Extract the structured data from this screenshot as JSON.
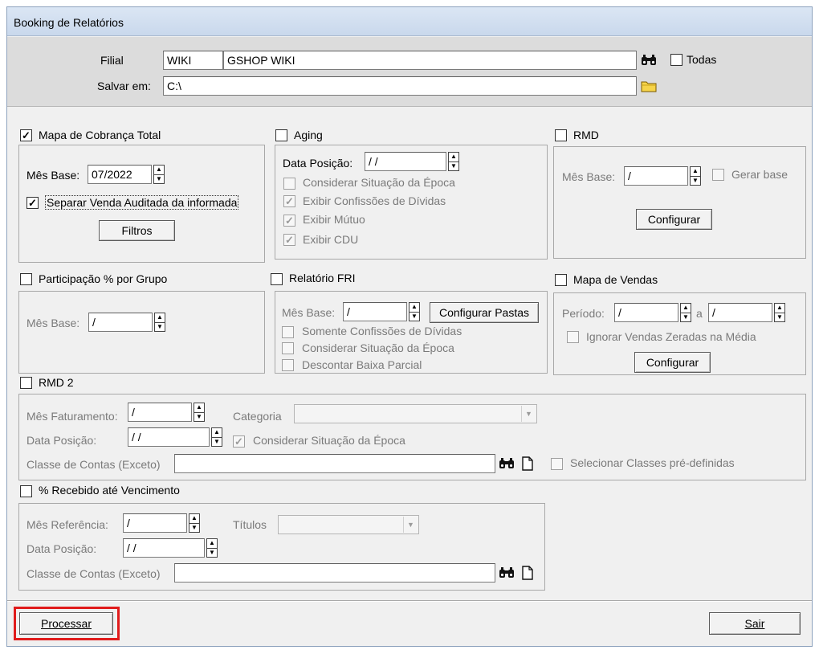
{
  "window": {
    "title": "Booking de Relatórios"
  },
  "header": {
    "filial_label": "Filial",
    "filial_code": "WIKI",
    "filial_name": "GSHOP WIKI",
    "todas_label": "Todas",
    "salvar_label": "Salvar em:",
    "salvar_path": "C:\\"
  },
  "mapa_cobranca": {
    "title": "Mapa de Cobrança Total",
    "checked": true,
    "mes_base_label": "Mês Base:",
    "mes_base_value": "07/2022",
    "separar_label": "Separar Venda Auditada da informada",
    "filtros_label": "Filtros"
  },
  "aging": {
    "title": "Aging",
    "data_posicao_label": "Data Posição:",
    "data_posicao_value": " / /",
    "opt1": "Considerar Situação da Época",
    "opt2": "Exibir Confissões de Dívidas",
    "opt3": "Exibir Mútuo",
    "opt4": "Exibir CDU"
  },
  "rmd": {
    "title": "RMD",
    "mes_base_label": "Mês Base:",
    "mes_base_value": " /",
    "gerar_base_label": "Gerar base",
    "configurar_label": "Configurar"
  },
  "participacao": {
    "title": "Participação % por Grupo",
    "mes_base_label": "Mês Base:",
    "mes_base_value": " /"
  },
  "fri": {
    "title": "Relatório FRI",
    "mes_base_label": "Mês Base:",
    "mes_base_value": " /",
    "configurar_pastas_label": "Configurar Pastas",
    "opt1": "Somente Confissões de Dívidas",
    "opt2": "Considerar Situação da Época",
    "opt3": "Descontar Baixa Parcial"
  },
  "mapa_vendas": {
    "title": "Mapa de Vendas",
    "periodo_label": "Período:",
    "periodo_from": " /",
    "a_label": "a",
    "periodo_to": " /",
    "ignorar_label": "Ignorar Vendas Zeradas na Média",
    "configurar_label": "Configurar"
  },
  "rmd2": {
    "title": "RMD 2",
    "mes_fat_label": "Mês Faturamento:",
    "mes_fat_value": " /",
    "categoria_label": "Categoria",
    "data_posicao_label": "Data Posição:",
    "data_posicao_value": " / /",
    "considerar_label": "Considerar Situação da Época",
    "classe_label": "Classe de Contas (Exceto)",
    "classe_value": "",
    "selecionar_label": "Selecionar Classes pré-definidas"
  },
  "recebido": {
    "title": "% Recebido até Vencimento",
    "mes_ref_label": "Mês Referência:",
    "mes_ref_value": " /",
    "titulos_label": "Títulos",
    "data_posicao_label": "Data Posição:",
    "data_posicao_value": " / /",
    "classe_label": "Classe de Contas (Exceto)",
    "classe_value": ""
  },
  "footer": {
    "processar_label": "Processar",
    "sair_label": "Sair"
  },
  "colors": {
    "highlight": "#e01b1b"
  }
}
